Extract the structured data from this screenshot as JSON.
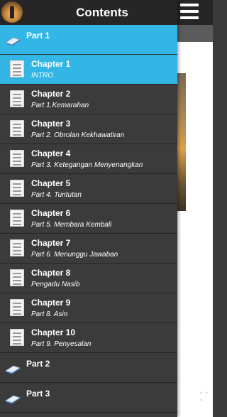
{
  "header": {
    "title": "Contents",
    "logo_icon": "book-cover-logo-icon",
    "menu_icon": "hamburger-menu-icon"
  },
  "colors": {
    "header_bg": "#262626",
    "drawer_bg": "#3b3b3b",
    "selected_bg": "#33b5e5",
    "text": "#ffffff"
  },
  "toc": {
    "part1": {
      "label": "Part 1",
      "icon": "book-icon"
    },
    "chapters": [
      {
        "title": "Chapter 1",
        "subtitle": "INTRO",
        "icon": "page-icon",
        "selected": false
      },
      {
        "title": "Chapter 2",
        "subtitle": "Part 1.Kemarahan",
        "icon": "page-icon"
      },
      {
        "title": "Chapter 3",
        "subtitle": "Part 2. Obrolan Kekhawatiran",
        "icon": "page-icon"
      },
      {
        "title": "Chapter 4",
        "subtitle": "Part 3. Ketegangan Menyenangkan",
        "icon": "page-icon"
      },
      {
        "title": "Chapter 5",
        "subtitle": "Part 4. Tuntutan",
        "icon": "page-icon"
      },
      {
        "title": "Chapter 6",
        "subtitle": "Part 5. Membara Kembali",
        "icon": "page-icon"
      },
      {
        "title": "Chapter 7",
        "subtitle": "Part 6. Menunggu Jawaban",
        "icon": "page-icon"
      },
      {
        "title": "Chapter 8",
        "subtitle": "Pengadu Nasib",
        "icon": "page-icon"
      },
      {
        "title": "Chapter 9",
        "subtitle": "Part 8. Asin",
        "icon": "page-icon"
      },
      {
        "title": "Chapter 10",
        "subtitle": "Part 9. Penyesalan",
        "icon": "page-icon"
      }
    ],
    "part2": {
      "label": "Part 2",
      "icon": "book-icon"
    },
    "part3": {
      "label": "Part 3",
      "icon": "book-icon"
    }
  }
}
